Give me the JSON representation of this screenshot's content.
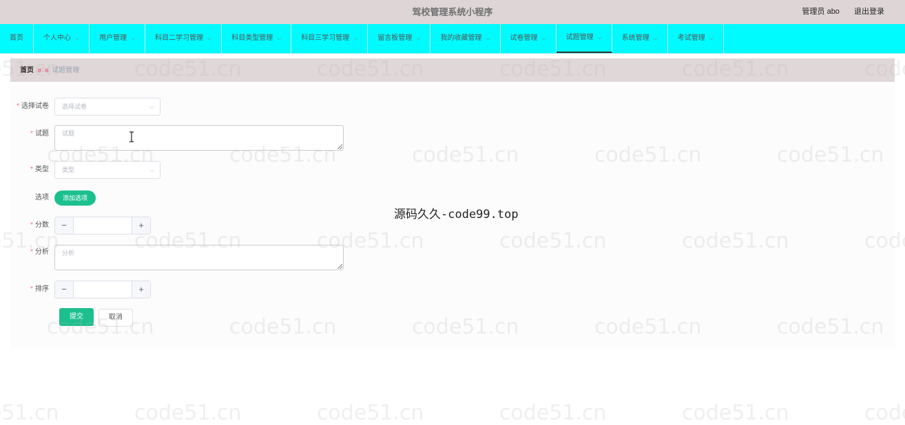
{
  "header": {
    "title": "驾校管理系统小程序",
    "user_label": "管理员 abo",
    "logout_label": "退出登录"
  },
  "nav": {
    "items": [
      {
        "label": "首页",
        "has_dropdown": false
      },
      {
        "label": "个人中心",
        "has_dropdown": true
      },
      {
        "label": "用户管理",
        "has_dropdown": true
      },
      {
        "label": "科目二学习管理",
        "has_dropdown": true
      },
      {
        "label": "科目类型管理",
        "has_dropdown": true
      },
      {
        "label": "科目三学习管理",
        "has_dropdown": true
      },
      {
        "label": "留言板管理",
        "has_dropdown": true
      },
      {
        "label": "我的收藏管理",
        "has_dropdown": true
      },
      {
        "label": "试卷管理",
        "has_dropdown": true
      },
      {
        "label": "试题管理",
        "has_dropdown": true,
        "active": true
      },
      {
        "label": "系统管理",
        "has_dropdown": true
      },
      {
        "label": "考试管理",
        "has_dropdown": true
      }
    ]
  },
  "breadcrumb": {
    "home": "首页",
    "separator": "ʚ♡ɞ",
    "current": "试题管理"
  },
  "form": {
    "paper": {
      "label": "选择试卷",
      "placeholder": "选择试卷"
    },
    "question": {
      "label": "试题",
      "placeholder": "试题"
    },
    "type": {
      "label": "类型",
      "placeholder": "类型"
    },
    "options": {
      "label": "选项",
      "add_button": "添加选项"
    },
    "score": {
      "label": "分数",
      "value": ""
    },
    "analysis": {
      "label": "分析",
      "placeholder": "分析"
    },
    "order": {
      "label": "排序",
      "value": ""
    },
    "submit_label": "提交",
    "cancel_label": "取消"
  },
  "overlay": {
    "center_text": "源码久久-code99.top",
    "watermark_text": "code51.cn"
  },
  "colors": {
    "nav_bg": "#00fbff",
    "header_bg": "#ded6d6",
    "accent": "#1cc08f",
    "required": "#f56c6c"
  }
}
